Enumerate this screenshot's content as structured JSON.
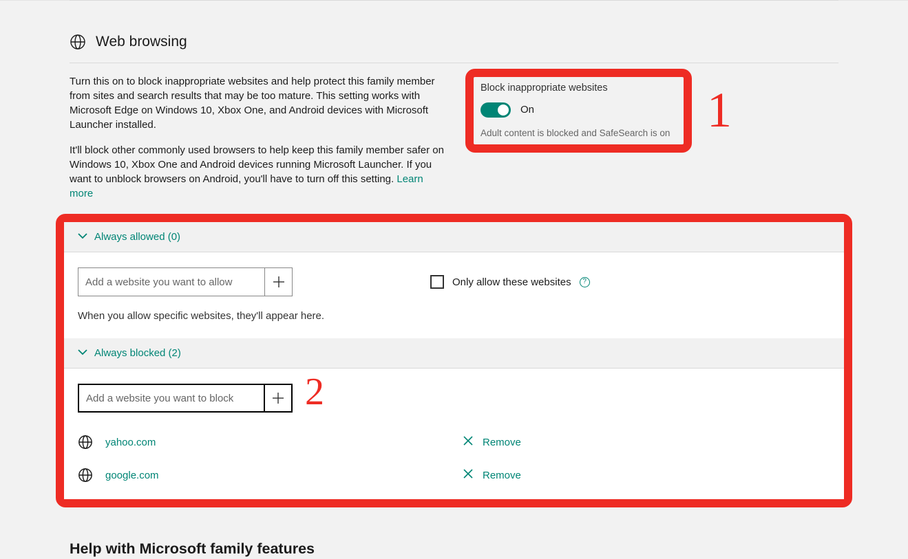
{
  "section": {
    "title": "Web browsing",
    "description1": "Turn this on to block inappropriate websites and help protect this family member from sites and search results that may be too mature. This setting works with Microsoft Edge on Windows 10, Xbox One, and Android devices with Microsoft Launcher installed.",
    "description2_a": "It'll block other commonly used browsers to help keep this family member safer on Windows 10, Xbox One and Android devices running Microsoft Launcher. If you want to unblock browsers on Android, you'll have to turn off this setting.  ",
    "learn_more": "Learn more"
  },
  "toggle": {
    "title": "Block inappropriate websites",
    "state": "On",
    "subtext": "Adult content is blocked and SafeSearch is on"
  },
  "allowed": {
    "header": "Always allowed (0)",
    "placeholder": "Add a website you want to allow",
    "help": "When you allow specific websites, they'll appear here.",
    "only_label": "Only allow these websites"
  },
  "blocked": {
    "header": "Always blocked (2)",
    "placeholder": "Add a website you want to block",
    "sites": [
      {
        "url": "yahoo.com",
        "remove": "Remove"
      },
      {
        "url": "google.com",
        "remove": "Remove"
      }
    ]
  },
  "annotations": {
    "n1": "1",
    "n2": "2"
  },
  "footer": {
    "heading": "Help with Microsoft family features"
  }
}
